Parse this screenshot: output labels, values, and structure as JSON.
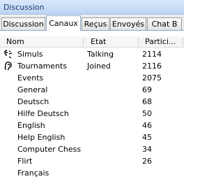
{
  "window": {
    "title": "Discussion"
  },
  "tabs": [
    {
      "label": "Discussion",
      "active": false
    },
    {
      "label": "Canaux",
      "active": true
    },
    {
      "label": "Reçus",
      "active": false
    },
    {
      "label": "Envoyés",
      "active": false
    },
    {
      "label": "Chat B",
      "active": false
    }
  ],
  "table": {
    "columns": [
      "Nom",
      "Etat",
      "Partici..."
    ],
    "rows": [
      {
        "name": "Simuls",
        "state": "Talking",
        "participants": "2114",
        "icon": "speech-icon"
      },
      {
        "name": "Tournaments",
        "state": "Joined",
        "participants": "2116",
        "icon": "ear-icon"
      },
      {
        "name": "Events",
        "state": "",
        "participants": "2075",
        "icon": ""
      },
      {
        "name": "General",
        "state": "",
        "participants": "69",
        "icon": ""
      },
      {
        "name": "Deutsch",
        "state": "",
        "participants": "68",
        "icon": ""
      },
      {
        "name": "Hilfe Deutsch",
        "state": "",
        "participants": "50",
        "icon": ""
      },
      {
        "name": "English",
        "state": "",
        "participants": "46",
        "icon": ""
      },
      {
        "name": "Help English",
        "state": "",
        "participants": "45",
        "icon": ""
      },
      {
        "name": "Computer Chess",
        "state": "",
        "participants": "34",
        "icon": ""
      },
      {
        "name": "Flirt",
        "state": "",
        "participants": "26",
        "icon": ""
      },
      {
        "name": "Français",
        "state": "",
        "participants": "",
        "icon": ""
      }
    ]
  }
}
